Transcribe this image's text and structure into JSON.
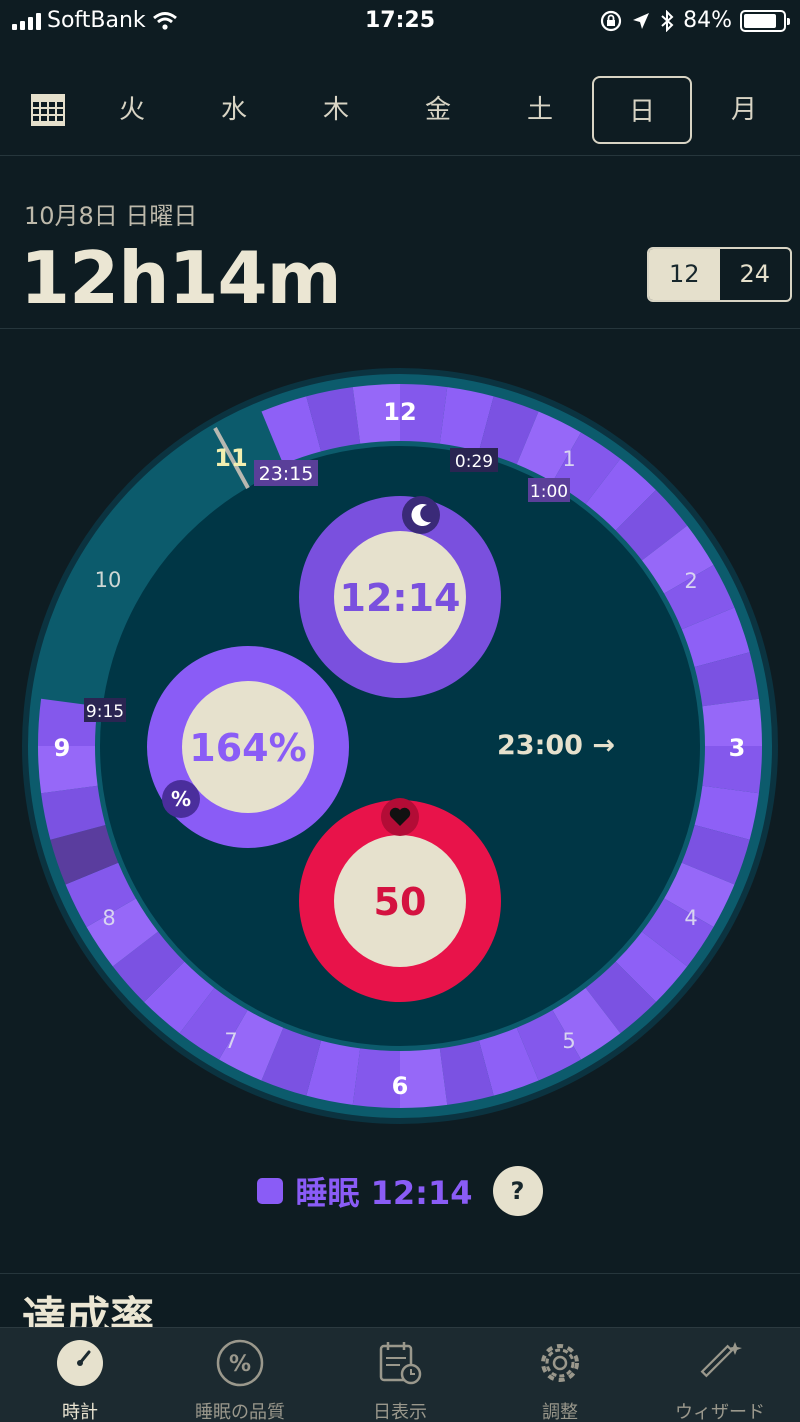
{
  "status_bar": {
    "carrier": "SoftBank",
    "time": "17:25",
    "battery": "84%",
    "battery_level": 0.84
  },
  "day_nav": {
    "days": [
      {
        "label": "火",
        "active": false
      },
      {
        "label": "水",
        "active": false
      },
      {
        "label": "木",
        "active": false
      },
      {
        "label": "金",
        "active": false
      },
      {
        "label": "土",
        "active": false
      },
      {
        "label": "日",
        "active": true
      },
      {
        "label": "月",
        "active": false
      }
    ]
  },
  "summary": {
    "date": "10月8日 日曜日",
    "duration": "12h14m",
    "format_options": [
      "12",
      "24"
    ],
    "format_selected": "12"
  },
  "clock": {
    "hour_labels": [
      "12",
      "1",
      "2",
      "3",
      "4",
      "5",
      "6",
      "7",
      "8",
      "9",
      "10",
      "11"
    ],
    "time_tags": [
      "23:15",
      "0:29",
      "1:00",
      "9:15"
    ],
    "center_label": "23:00 →",
    "rings": {
      "duration": "12:14",
      "quality": "164%",
      "quality_badge": "%",
      "heart": "50"
    },
    "colors": {
      "sleep": "#8a5cf6",
      "heart": "#e8134a",
      "awake": "#0c5b6c",
      "face": "#003645",
      "core": "#e6e1cd"
    }
  },
  "legend": {
    "label": "睡眠 12:14",
    "help": "?"
  },
  "section": {
    "title": "達成率"
  },
  "tabbar": {
    "tabs": [
      {
        "label": "時計",
        "icon": "clock-icon",
        "active": true
      },
      {
        "label": "睡眠の品質",
        "icon": "percent-icon",
        "active": false
      },
      {
        "label": "日表示",
        "icon": "calendar-icon",
        "active": false
      },
      {
        "label": "調整",
        "icon": "gear-icon",
        "active": false
      },
      {
        "label": "ウィザード",
        "icon": "magic-wand-icon",
        "active": false
      }
    ]
  }
}
